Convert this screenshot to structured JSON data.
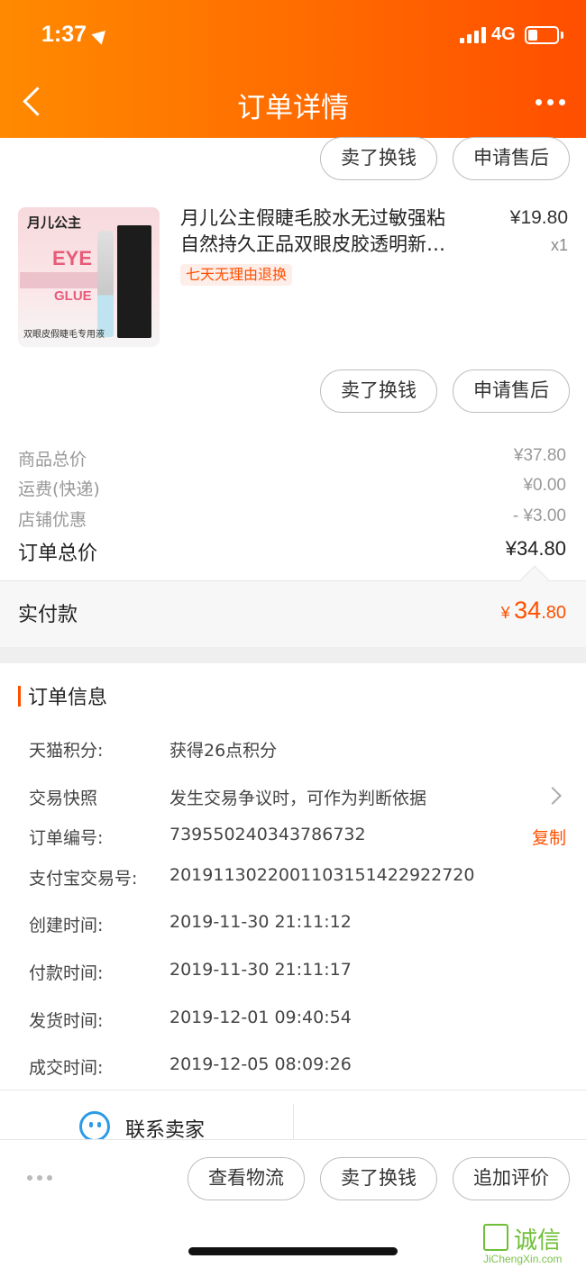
{
  "status_bar": {
    "time": "1:37",
    "network": "4G"
  },
  "nav": {
    "title": "订单详情"
  },
  "top_buttons": {
    "sell_label": "卖了换钱",
    "aftersale_label": "申请售后"
  },
  "product": {
    "image_brand": "月儿公主",
    "image_eye": "EYE",
    "image_glue": "GLUE",
    "image_caption": "双眼皮假睫毛专用液",
    "title_line1": "月儿公主假睫毛胶水无过敏强粘",
    "title_line2": "自然持久正品双眼皮胶透明新…",
    "price": "¥19.80",
    "qty": "x1",
    "tag": "七天无理由退换",
    "sell_label": "卖了换钱",
    "aftersale_label": "申请售后"
  },
  "summary": {
    "goods_label": "商品总价",
    "goods_value": "¥37.80",
    "shipping_label": "运费(快递)",
    "shipping_value": "¥0.00",
    "discount_label": "店铺优惠",
    "discount_value": "- ¥3.00",
    "total_label": "订单总价",
    "total_value": "¥34.80",
    "paid_label": "实付款",
    "paid_currency": "¥",
    "paid_int": "34",
    "paid_dec": ".80"
  },
  "order_info": {
    "section_title": "订单信息",
    "rows": [
      {
        "label": "天猫积分:",
        "value": "获得26点积分"
      },
      {
        "label": "交易快照",
        "value": "发生交易争议时，可作为判断依据"
      },
      {
        "label": "订单编号:",
        "value": "739550240343786732"
      },
      {
        "label": "支付宝交易号:",
        "value": "2019113022001103151422922720"
      },
      {
        "label": "创建时间:",
        "value": "2019-11-30 21:11:12"
      },
      {
        "label": "付款时间:",
        "value": "2019-11-30 21:11:17"
      },
      {
        "label": "发货时间:",
        "value": "2019-12-01 09:40:54"
      },
      {
        "label": "成交时间:",
        "value": "2019-12-05 08:09:26"
      }
    ],
    "copy_label": "复制"
  },
  "contact": {
    "label": "联系卖家"
  },
  "bottom_bar": {
    "logistics_label": "查看物流",
    "sell_label": "卖了换钱",
    "review_label": "追加评价"
  },
  "watermark": {
    "text": "诚信",
    "url": "JiChengXin.com"
  },
  "colors": {
    "accent": "#ff5000",
    "header_start": "#ff8a00",
    "header_end": "#ff4e00"
  }
}
